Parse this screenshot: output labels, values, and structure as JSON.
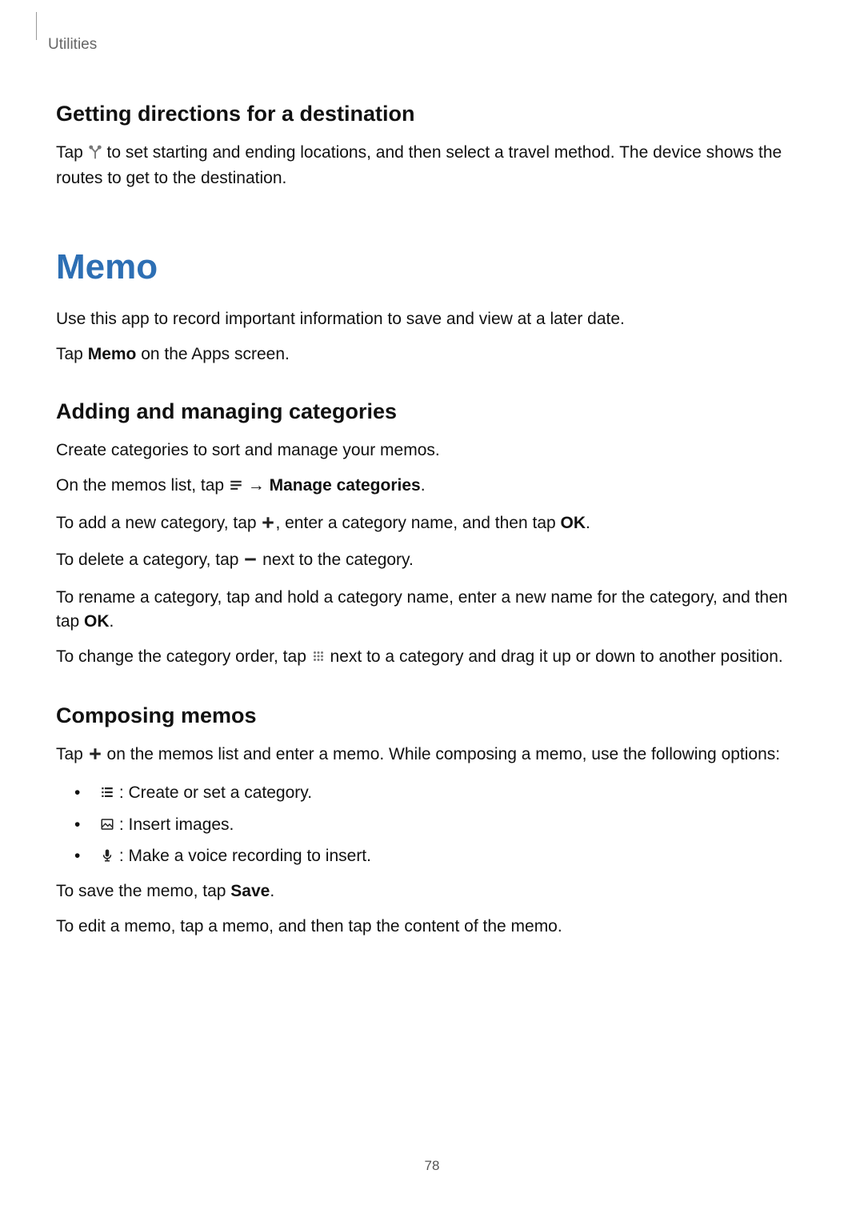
{
  "header": {
    "breadcrumb": "Utilities"
  },
  "accent_color": "#2d6fb4",
  "section_directions": {
    "heading": "Getting directions for a destination",
    "p1_a": "Tap ",
    "p1_b": " to set starting and ending locations, and then select a travel method. The device shows the routes to get to the destination."
  },
  "section_memo": {
    "title": "Memo",
    "intro": "Use this app to record important information to save and view at a later date.",
    "tap_a": "Tap ",
    "tap_b": "Memo",
    "tap_c": " on the Apps screen."
  },
  "section_categories": {
    "heading": "Adding and managing categories",
    "p_create": "Create categories to sort and manage your memos.",
    "p_on_a": "On the memos list, tap ",
    "p_on_arrow": " → ",
    "p_on_b": "Manage categories",
    "p_on_c": ".",
    "p_add_a": "To add a new category, tap ",
    "p_add_b": ", enter a category name, and then tap ",
    "p_add_ok": "OK",
    "p_add_c": ".",
    "p_del_a": "To delete a category, tap ",
    "p_del_b": " next to the category.",
    "p_rename_a": "To rename a category, tap and hold a category name, enter a new name for the category, and then tap ",
    "p_rename_ok": "OK",
    "p_rename_b": ".",
    "p_order_a": "To change the category order, tap ",
    "p_order_b": " next to a category and drag it up or down to another position."
  },
  "section_composing": {
    "heading": "Composing memos",
    "p_tap_a": "Tap ",
    "p_tap_b": " on the memos list and enter a memo. While composing a memo, use the following options:",
    "bullet_cat": " : Create or set a category.",
    "bullet_img": " : Insert images.",
    "bullet_voice": " : Make a voice recording to insert.",
    "p_save_a": "To save the memo, tap ",
    "p_save_b": "Save",
    "p_save_c": ".",
    "p_edit": "To edit a memo, tap a memo, and then tap the content of the memo."
  },
  "page_number": "78"
}
